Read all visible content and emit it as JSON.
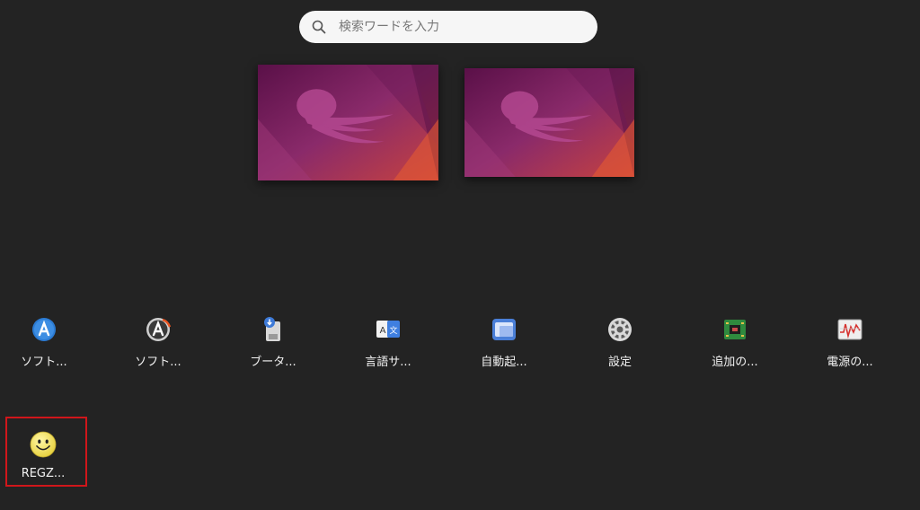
{
  "search": {
    "placeholder": "検索ワードを入力",
    "icon": "search-icon"
  },
  "workspaces": [
    {
      "name": "workspace-1",
      "wallpaper": "jellyfish-wallpaper"
    },
    {
      "name": "workspace-2",
      "wallpaper": "jellyfish-wallpaper"
    }
  ],
  "apps": [
    {
      "label": "ソフト...",
      "icon": "software-store-icon"
    },
    {
      "label": "ソフト...",
      "icon": "software-updater-icon"
    },
    {
      "label": "ブータ...",
      "icon": "usb-creator-icon"
    },
    {
      "label": "言語サ...",
      "icon": "language-support-icon"
    },
    {
      "label": "自動起...",
      "icon": "startup-apps-icon"
    },
    {
      "label": "設定",
      "icon": "settings-gear-icon"
    },
    {
      "label": "追加の...",
      "icon": "additional-drivers-icon"
    },
    {
      "label": "電源の...",
      "icon": "power-stats-icon"
    },
    {
      "label": "REGZ...",
      "icon": "smiley-face-icon"
    }
  ],
  "colors": {
    "background": "#232323",
    "selection_outline": "#d0161b",
    "wallpaper_purple": "#77216f",
    "wallpaper_orange": "#e95420"
  }
}
